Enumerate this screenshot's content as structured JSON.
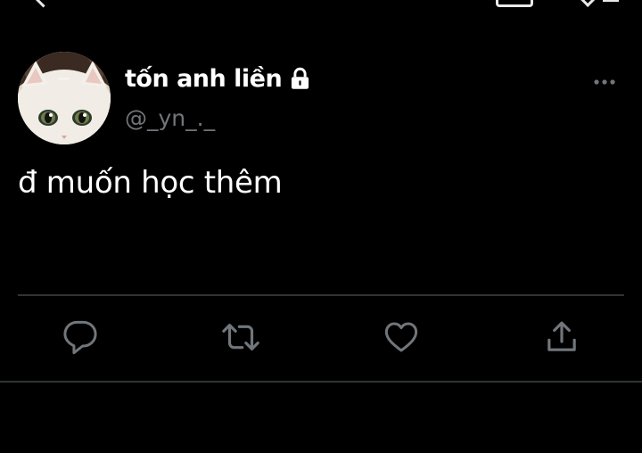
{
  "tweet": {
    "display_name": "tốn anh liền",
    "handle": "@_yn_._",
    "text": "đ muốn học thêm",
    "avatar_label": "ꟷꟷ"
  },
  "icons": {
    "lock": "lock-icon",
    "more": "more-horizontal-icon",
    "reply": "reply-icon",
    "retweet": "retweet-icon",
    "like": "heart-icon",
    "share": "share-icon"
  },
  "colors": {
    "background": "#000000",
    "text_primary": "#ffffff",
    "text_secondary": "#71767b",
    "icon": "#71767b",
    "divider": "#2f3336"
  }
}
